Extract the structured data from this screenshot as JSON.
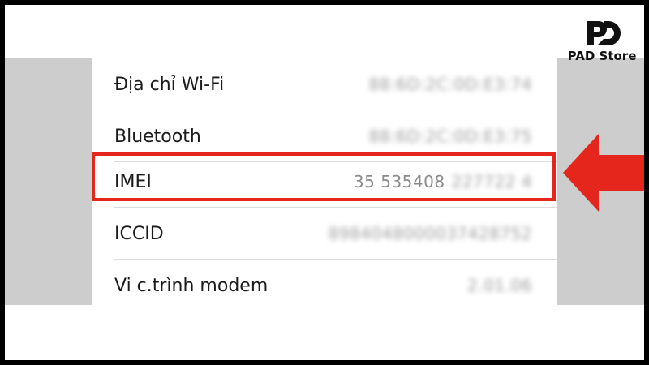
{
  "brand": {
    "name": "PAD Store",
    "logo_icon": "pad-logo-icon"
  },
  "settings_rows": [
    {
      "label": "Địa chỉ Wi-Fi",
      "value": "88:6D:2C:0D:E3:74",
      "blurred": true
    },
    {
      "label": "Bluetooth",
      "value": "88:6D:2C:0D:E3:75",
      "blurred": true
    },
    {
      "label": "IMEI",
      "value_visible": "35 535408",
      "value_hidden": "227722 4",
      "highlighted": true
    },
    {
      "label": "ICCID",
      "value": "8984048000037428752",
      "blurred": true
    },
    {
      "label": "Vi c.trình modem",
      "value": "2.01.06",
      "blurred": true
    }
  ],
  "colors": {
    "highlight": "#e5261d",
    "arrow": "#e5261d",
    "side_panel": "#cdcdcd"
  }
}
